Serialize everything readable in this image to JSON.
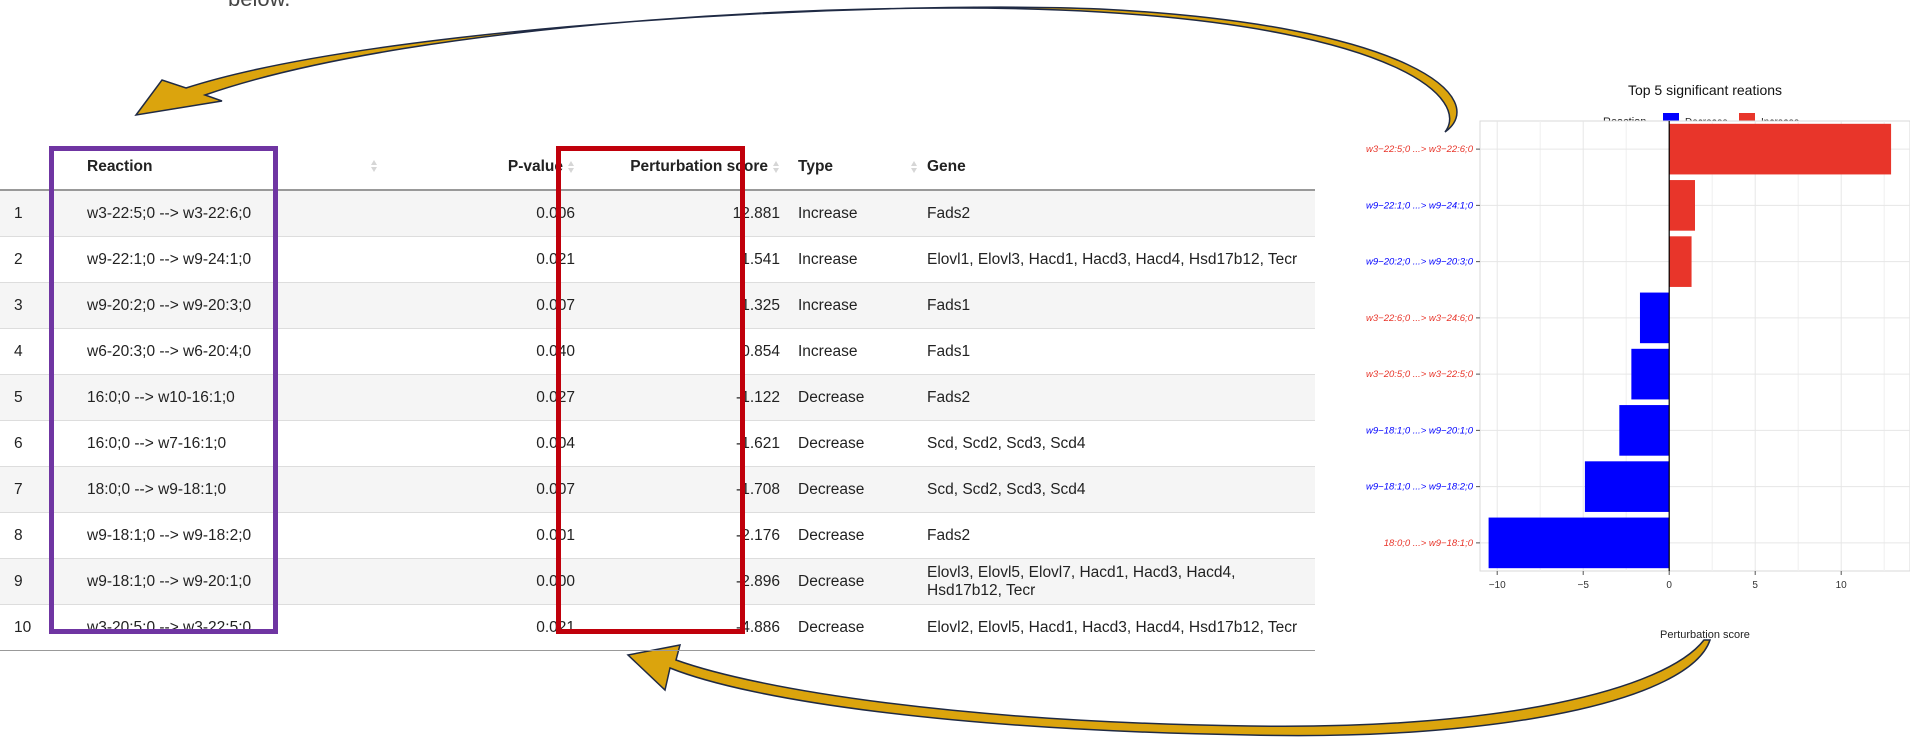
{
  "top_cut_text": "below.",
  "table": {
    "headers": {
      "index": "",
      "reaction": "Reaction",
      "pvalue": "P-value",
      "score": "Perturbation score",
      "type": "Type",
      "gene": "Gene"
    },
    "rows": [
      {
        "index": "1",
        "reaction": "w3-22:5;0 --> w3-22:6;0",
        "pvalue": "0.006",
        "score": "12.881",
        "type": "Increase",
        "gene": "Fads2"
      },
      {
        "index": "2",
        "reaction": "w9-22:1;0 --> w9-24:1;0",
        "pvalue": "0.021",
        "score": "1.541",
        "type": "Increase",
        "gene": "Elovl1, Elovl3, Hacd1, Hacd3, Hacd4, Hsd17b12, Tecr"
      },
      {
        "index": "3",
        "reaction": "w9-20:2;0 --> w9-20:3;0",
        "pvalue": "0.007",
        "score": "1.325",
        "type": "Increase",
        "gene": "Fads1"
      },
      {
        "index": "4",
        "reaction": "w6-20:3;0 --> w6-20:4;0",
        "pvalue": "0.040",
        "score": "0.854",
        "type": "Increase",
        "gene": "Fads1"
      },
      {
        "index": "5",
        "reaction": "16:0;0 --> w10-16:1;0",
        "pvalue": "0.027",
        "score": "-1.122",
        "type": "Decrease",
        "gene": "Fads2"
      },
      {
        "index": "6",
        "reaction": "16:0;0 --> w7-16:1;0",
        "pvalue": "0.004",
        "score": "-1.621",
        "type": "Decrease",
        "gene": "Scd, Scd2, Scd3, Scd4"
      },
      {
        "index": "7",
        "reaction": "18:0;0 --> w9-18:1;0",
        "pvalue": "0.007",
        "score": "-1.708",
        "type": "Decrease",
        "gene": "Scd, Scd2, Scd3, Scd4"
      },
      {
        "index": "8",
        "reaction": "w9-18:1;0 --> w9-18:2;0",
        "pvalue": "0.001",
        "score": "-2.176",
        "type": "Decrease",
        "gene": "Fads2"
      },
      {
        "index": "9",
        "reaction": "w9-18:1;0 --> w9-20:1;0",
        "pvalue": "0.000",
        "score": "-2.896",
        "type": "Decrease",
        "gene": "Elovl3, Elovl5, Elovl7, Hacd1, Hacd3, Hacd4, Hsd17b12, Tecr"
      },
      {
        "index": "10",
        "reaction": "w3-20:5;0 --> w3-22:5;0",
        "pvalue": "0.021",
        "score": "-4.886",
        "type": "Decrease",
        "gene": "Elovl2, Elovl5, Hacd1, Hacd3, Hacd4, Hsd17b12, Tecr"
      }
    ]
  },
  "colors": {
    "purple_box": "#6f35a2",
    "red_box": "#c0000b",
    "arrow_fill": "#dba40d",
    "arrow_stroke": "#1f2a44",
    "decrease": "#0000ff",
    "increase": "#e8352a"
  },
  "chart_data": {
    "type": "bar",
    "orientation": "horizontal",
    "title": "Top 5 significant reations",
    "legend": {
      "title": "Reaction",
      "position": "top",
      "items": [
        {
          "name": "Decrease",
          "color": "#0000ff"
        },
        {
          "name": "Increase",
          "color": "#e8352a"
        }
      ]
    },
    "xlabel": "Perturbation score",
    "xlim": [
      -11,
      14
    ],
    "xticks": [
      -10,
      -5,
      0,
      5,
      10
    ],
    "xtick_labels": [
      "−10",
      "−5",
      "0",
      "5",
      "10"
    ],
    "grid": true,
    "categories": [
      "w3−22:5;0 ...> w3−22:6;0",
      "w9−22:1;0 ...> w9−24:1;0",
      "w9−20:2;0 ...> w9−20:3;0",
      "w3−22:6;0 ...> w3−24:6;0",
      "w3−20:5;0 ...> w3−22:5;0",
      "w9−18:1;0 ...> w9−20:1;0",
      "w9−18:1;0 ...> w9−18:2;0",
      "18:0;0 ...> w9−18:1;0"
    ],
    "category_label_colors": [
      "#e8352a",
      "#0000ff",
      "#0000ff",
      "#e8352a",
      "#e8352a",
      "#0000ff",
      "#0000ff",
      "#e8352a"
    ],
    "values": [
      12.9,
      1.5,
      1.3,
      -1.7,
      -2.2,
      -2.9,
      -4.9,
      -10.5
    ]
  }
}
